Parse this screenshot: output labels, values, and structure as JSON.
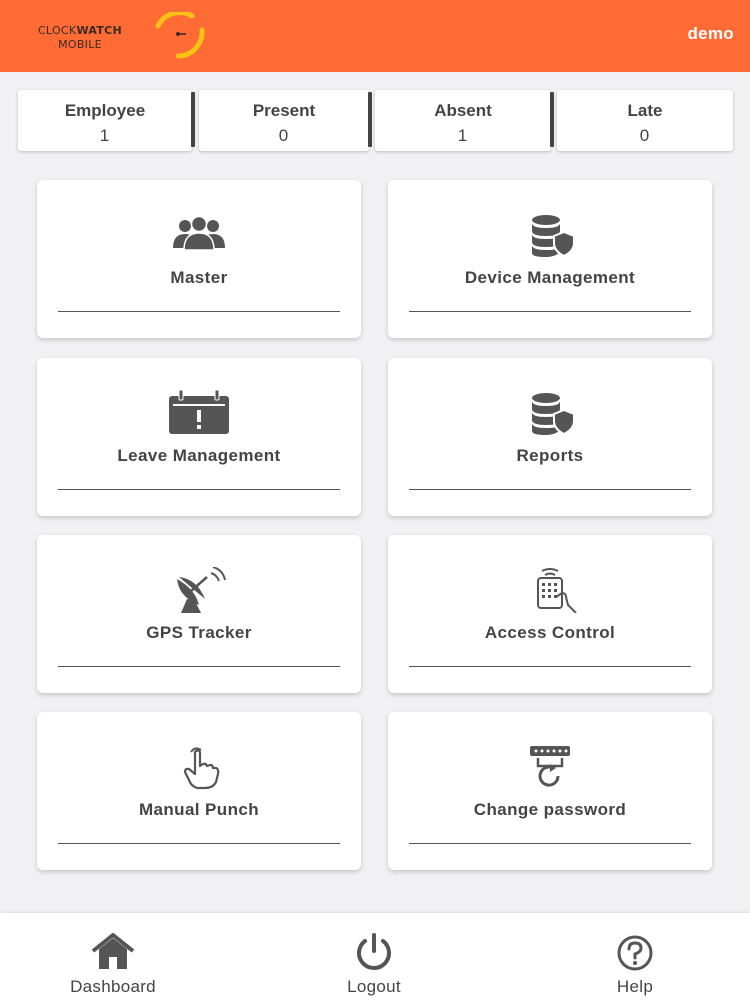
{
  "header": {
    "logo_text_line1_light": "CLOCK",
    "logo_text_line1_bold": "WATCH",
    "logo_text_line2": "MOBILE",
    "username": "demo",
    "accent_color": "#ff6b35",
    "logo_ring_color": "#f6c213"
  },
  "stats": [
    {
      "label": "Employee",
      "value": "1"
    },
    {
      "label": "Present",
      "value": "0"
    },
    {
      "label": "Absent",
      "value": "1"
    },
    {
      "label": "Late",
      "value": "0"
    }
  ],
  "menu": [
    {
      "label": "Master",
      "icon": "users-group-icon"
    },
    {
      "label": "Device Management",
      "icon": "database-shield-icon"
    },
    {
      "label": "Leave Management",
      "icon": "calendar-alert-icon"
    },
    {
      "label": "Reports",
      "icon": "database-shield-icon"
    },
    {
      "label": "GPS Tracker",
      "icon": "satellite-dish-icon"
    },
    {
      "label": "Access Control",
      "icon": "keypad-hand-icon"
    },
    {
      "label": "Manual Punch",
      "icon": "hand-touch-icon"
    },
    {
      "label": "Change password",
      "icon": "password-reset-icon"
    }
  ],
  "bottom_nav": [
    {
      "label": "Dashboard",
      "icon": "home-icon"
    },
    {
      "label": "Logout",
      "icon": "power-icon"
    },
    {
      "label": "Help",
      "icon": "help-circle-icon"
    }
  ]
}
